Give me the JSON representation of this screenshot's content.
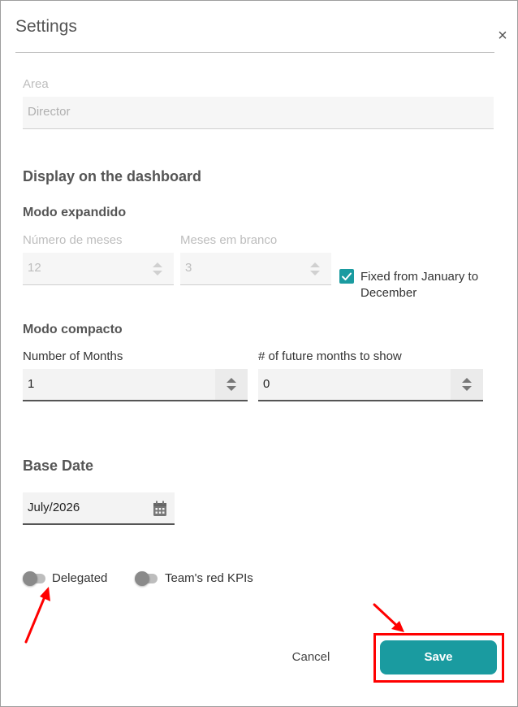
{
  "dialog": {
    "title": "Settings",
    "close_glyph": "×"
  },
  "area": {
    "label": "Area",
    "value": "Director"
  },
  "display": {
    "heading": "Display on the dashboard"
  },
  "expanded": {
    "heading": "Modo expandido",
    "months_label": "Número de meses",
    "months_value": "12",
    "blank_label": "Meses em branco",
    "blank_value": "3",
    "fixed_label": "Fixed from January to December",
    "fixed_checked": true
  },
  "compact": {
    "heading": "Modo compacto",
    "months_label": "Number of Months",
    "months_value": "1",
    "future_label": "# of future months to show",
    "future_value": "0"
  },
  "base_date": {
    "heading": "Base Date",
    "value": "July/2026"
  },
  "toggles": {
    "delegated_label": "Delegated",
    "team_red_label": "Team's red KPIs"
  },
  "actions": {
    "cancel_label": "Cancel",
    "save_label": "Save"
  },
  "colors": {
    "accent": "#1a9ba0",
    "annotation": "#ff0000"
  },
  "icons": {
    "close": "close-icon",
    "checkbox": "check-icon",
    "calendar": "calendar-icon",
    "spinner": "spinner-arrows-icon"
  }
}
